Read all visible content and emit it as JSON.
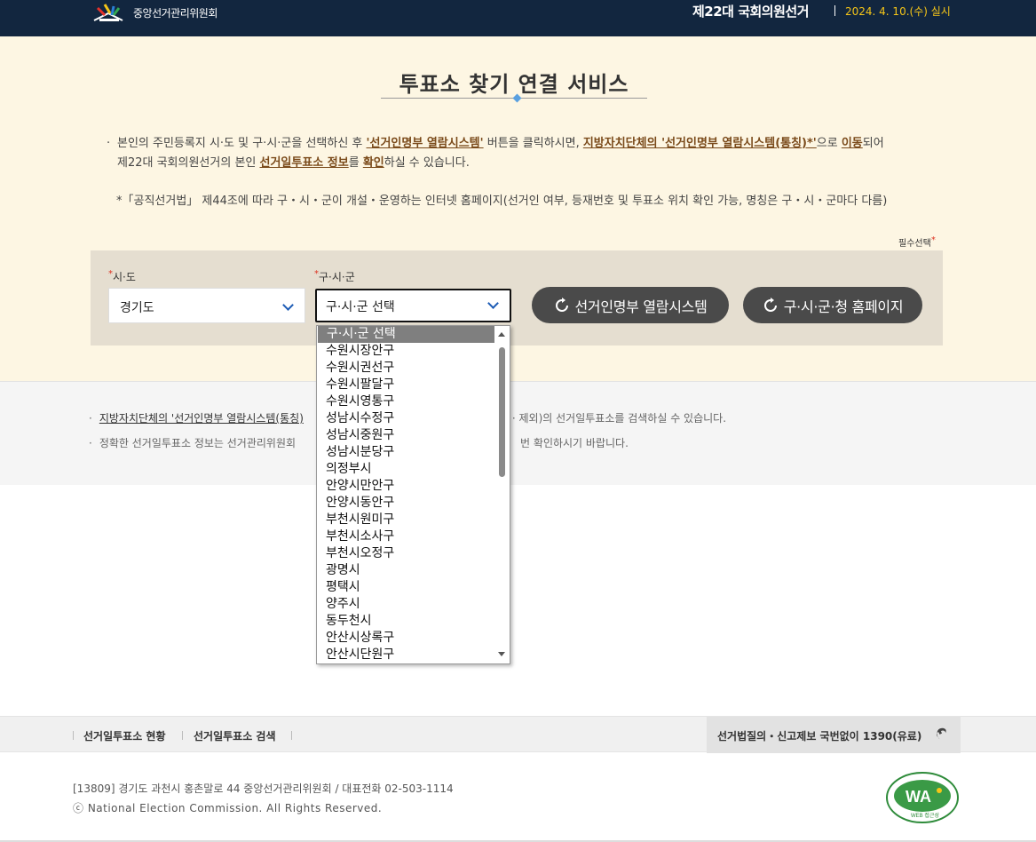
{
  "header": {
    "logo_text": "중앙선거관리위원회",
    "election_title": "제22대 국회의원선거",
    "election_date": "2024. 4. 10.(수) 실시"
  },
  "main": {
    "title": "투표소 찾기 연결 서비스",
    "desc_part1": "본인의 주민등록지 시·도 및 구·시·군을 선택하신 후 ",
    "desc_link1": "'선거인명부 열람시스템'",
    "desc_part2": " 버튼을 클릭하시면, ",
    "desc_link2": "지방자치단체의 '선거인명부 열람시스템(통칭)*'",
    "desc_part3": "으로 ",
    "desc_link3": "이동",
    "desc_part4": "되어",
    "desc_line2_part1": "제22대 국회의원선거의 본인 ",
    "desc_line2_link1": "선거일투표소 정보",
    "desc_line2_part2": "를 ",
    "desc_line2_link2": "확인",
    "desc_line2_part3": "하실 수 있습니다.",
    "note": "*「공직선거법」 제44조에 따라 구・시・군이 개설・운영하는 인터넷 홈페이지(선거인 여부, 등재번호 및 투표소 위치 확인 가능, 명칭은 구・시・군마다 다름)",
    "required_label": "필수선택"
  },
  "search": {
    "sido_label": "시·도",
    "sido_value": "경기도",
    "gu_label": "구·시·군",
    "gu_value": "구·시·군 선택",
    "btn_registry": "선거인명부 열람시스템",
    "btn_homepage": "구·시·군·청 홈페이지"
  },
  "dropdown": {
    "options": [
      "구·시·군 선택",
      "수원시장안구",
      "수원시권선구",
      "수원시팔달구",
      "수원시영통구",
      "성남시수정구",
      "성남시중원구",
      "성남시분당구",
      "의정부시",
      "안양시만안구",
      "안양시동안구",
      "부천시원미구",
      "부천시소사구",
      "부천시오정구",
      "광명시",
      "평택시",
      "양주시",
      "동두천시",
      "안산시상록구",
      "안산시단원구"
    ]
  },
  "info": {
    "line1_link": "지방자치단체의 '선거인명부 열람시스템(통칭)",
    "line1_rest": "· 제외)의 선거일투표소를 검색하실 수 있습니다.",
    "line2_start": "정확한 선거일투표소 정보는 선거관리위원회",
    "line2_rest": "번 확인하시기 바랍니다."
  },
  "footer": {
    "nav_status": "선거일투표소 현황",
    "nav_search": "선거일투표소 검색",
    "hotline": "선거법질의・신고제보 국번없이 1390(유료)",
    "address": "[13809] 경기도 과천시 홍촌말로 44 중앙선거관리위원회 / 대표전화 02-503-1114",
    "copyright": "ⓒ National Election Commission. All Rights Reserved.",
    "wa_text": "WA",
    "wa_sub": "WEB 접근성"
  }
}
